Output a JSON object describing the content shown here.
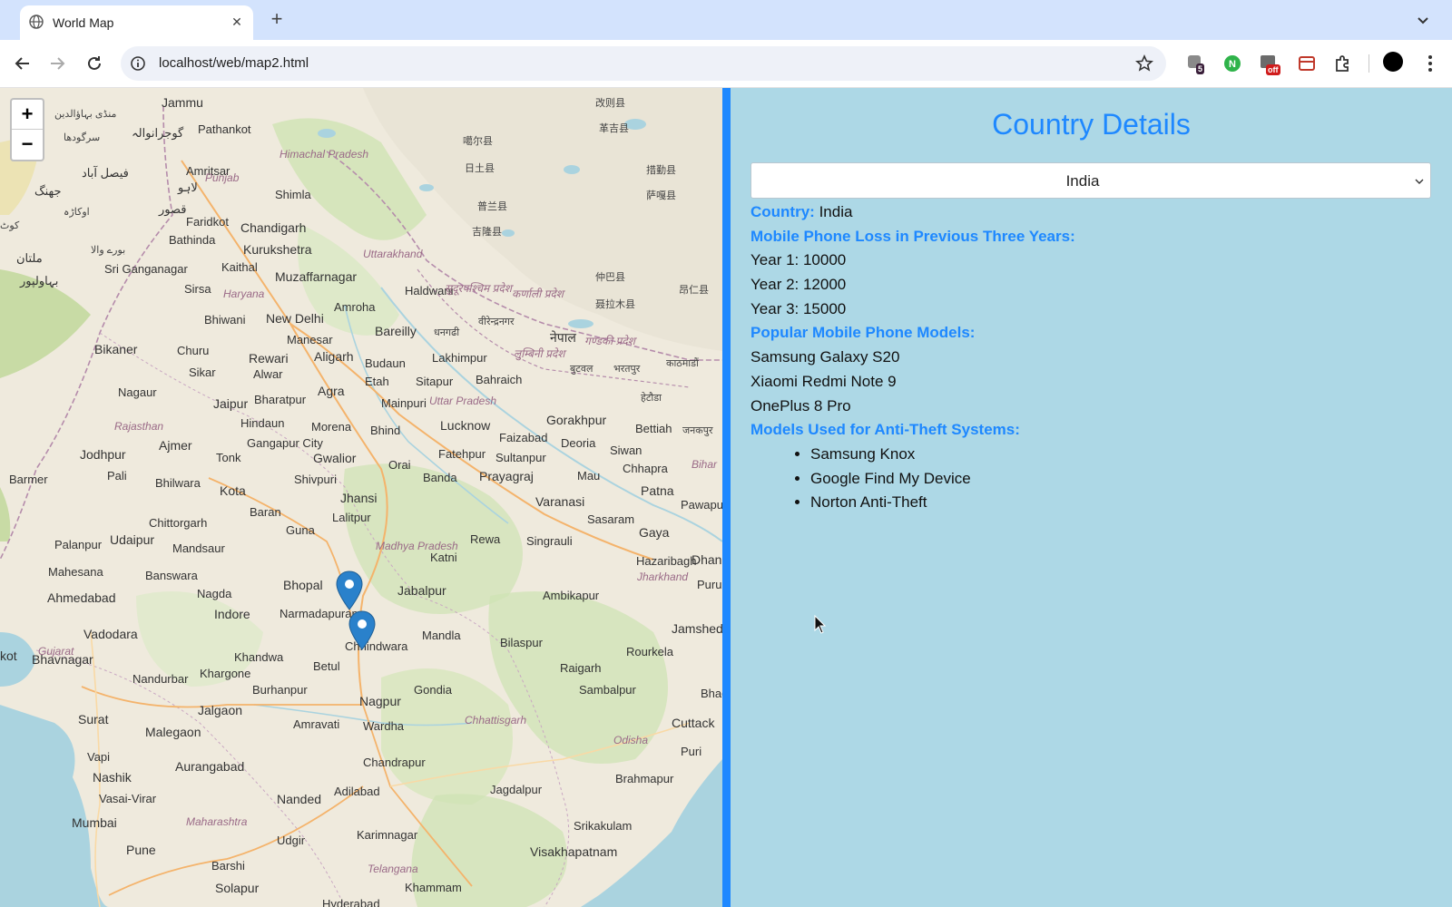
{
  "browser": {
    "tab_title": "World Map",
    "url": "localhost/web/map2.html",
    "extensions": [
      {
        "name": "ext-badge-5",
        "badge": "5"
      },
      {
        "name": "ext-green-n"
      },
      {
        "name": "ext-off",
        "badge": "off"
      },
      {
        "name": "ext-red"
      },
      {
        "name": "puzzle-icon"
      }
    ]
  },
  "map": {
    "zoom_in": "+",
    "zoom_out": "−",
    "labels": {
      "jammu": "Jammu",
      "pathankot": "Pathankot",
      "amritsar": "Amritsar",
      "gujranwala": "گوجرانوالہ",
      "mandi_bahauddin": "منڈی بہاؤالدین",
      "sargodha": "سرگودھا",
      "faisalabad": "فیصل آباد",
      "jhang": "جھنگ",
      "okara": "اوکاڑہ",
      "lahore": "لاہو",
      "qasur": "قصور",
      "burewala": "بورے والا",
      "multan": "ملتان",
      "bahawalpur": "بہاولپور",
      "kot": "کوٹ",
      "himachal": "Himachal Pradesh",
      "shimla": "Shimla",
      "punjab": "Punjab",
      "faridkot": "Faridkot",
      "bathinda": "Bathinda",
      "chandigarh": "Chandigarh",
      "kurukshetra": "Kurukshetra",
      "sri_ganganagar": "Sri Ganganagar",
      "kaithal": "Kaithal",
      "uttarakhand": "Uttarakhand",
      "muzaffarnagar": "Muzaffarnagar",
      "haryana": "Haryana",
      "sirsa": "Sirsa",
      "haldwani": "Haldwani",
      "amroha": "Amroha",
      "bhiwani": "Bhiwani",
      "new_delhi": "New Delhi",
      "bareilly": "Bareilly",
      "manesar": "Manesar",
      "bikaner": "Bikaner",
      "churu": "Churu",
      "rewari": "Rewari",
      "aligarh": "Aligarh",
      "budaun": "Budaun",
      "sikar": "Sikar",
      "alwar": "Alwar",
      "etah": "Etah",
      "sitapur": "Sitapur",
      "nagaur": "Nagaur",
      "jaipur": "Jaipur",
      "agra": "Agra",
      "bharatpur": "Bharatpur",
      "mainpuri": "Mainpuri",
      "uttar_pradesh": "Uttar Pradesh",
      "hindaun": "Hindaun",
      "morena": "Morena",
      "bhind": "Bhind",
      "lucknow": "Lucknow",
      "rajasthan": "Rajasthan",
      "ajmer": "Ajmer",
      "gangapur": "Gangapur City",
      "gwalior": "Gwalior",
      "fatehpur": "Fatehpur",
      "jodhpur": "Jodhpur",
      "tonk": "Tonk",
      "pali": "Pali",
      "orai": "Orai",
      "banda": "Banda",
      "prayagraj": "Prayagraj",
      "shivpuri": "Shivpuri",
      "barmer": "Barmer",
      "bhilwara": "Bhilwara",
      "kota": "Kota",
      "jhansi": "Jhansi",
      "lalitpur": "Lalitpur",
      "baran": "Baran",
      "chittorgarh": "Chittorgarh",
      "guna": "Guna",
      "palanpur": "Palanpur",
      "udaipur": "Udaipur",
      "mandsaur": "Mandsaur",
      "madhya_pradesh": "Madhya Pradesh",
      "katni": "Katni",
      "rewa": "Rewa",
      "singrauli": "Singrauli",
      "mahesana": "Mahesana",
      "banswara": "Banswara",
      "bhopal": "Bhopal",
      "jabalpur": "Jabalpur",
      "ahmedabad": "Ahmedabad",
      "nagda": "Nagda",
      "indore": "Indore",
      "narmadapuram": "Narmadapuram",
      "chhindwara": "Chhindwara",
      "mandla": "Mandla",
      "vadodara": "Vadodara",
      "gujarat": "Gujarat",
      "khandwa": "Khandwa",
      "bhavnagar": "Bhavnagar",
      "kot2": "kot",
      "nandurbar": "Nandurbar",
      "khargone": "Khargone",
      "betul": "Betul",
      "burhanpur": "Burhanpur",
      "jalgaon": "Jalgaon",
      "nagpur": "Nagpur",
      "gondia": "Gondia",
      "surat": "Surat",
      "amravati": "Amravati",
      "wardha": "Wardha",
      "malegaon": "Malegaon",
      "chhattisgarh": "Chhattisgarh",
      "vapi": "Vapi",
      "aurangabad": "Aurangabad",
      "nashik": "Nashik",
      "chandrapur": "Chandrapur",
      "vasai_virar": "Vasai-Virar",
      "nanded": "Nanded",
      "adilabad": "Adilabad",
      "mumbai": "Mumbai",
      "maharashtra": "Maharashtra",
      "pune": "Pune",
      "udgir": "Udgir",
      "karimnagar": "Karimnagar",
      "telangana": "Telangana",
      "barshi": "Barshi",
      "solapur": "Solapur",
      "hyderabad": "Hyderabad",
      "khammam": "Khammam",
      "varanasi": "Varanasi",
      "gorakhpur": "Gorakhpur",
      "faizabad": "Faizabad",
      "deoria": "Deoria",
      "siwan": "Siwan",
      "bettiah": "Bettiah",
      "chhapra": "Chhapra",
      "mau": "Mau",
      "sultanpur": "Sultanpur",
      "bahraich": "Bahraich",
      "lakhimpur": "Lakhimpur",
      "patna": "Patna",
      "gaya": "Gaya",
      "sasaram": "Sasaram",
      "bihar": "Bihar",
      "pawapur": "Pawapur",
      "hazaribagh": "Hazaribagh",
      "dhan": "Dhan",
      "jharkhand": "Jharkhand",
      "purul": "Purul",
      "ambikapur": "Ambikapur",
      "jamshed": "Jamshed",
      "bilaspur": "Bilaspur",
      "rourkela": "Rourkela",
      "raigarh": "Raigarh",
      "sambalpur": "Sambalpur",
      "bhad": "Bhad",
      "cuttack": "Cuttack",
      "odisha": "Odisha",
      "puri": "Puri",
      "brahmapur": "Brahmapur",
      "jagdalpur": "Jagdalpur",
      "srikakulam": "Srikakulam",
      "visakhapatnam": "Visakhapatnam",
      "nepal": "नेपाल",
      "lumbini": "लुम्बिनी प्रदेश",
      "sudurpashchim": "सुदूरपश्चिम प्रदेश",
      "karnali": "कर्णाली प्रदेश",
      "dhangadhi": "धनगढी",
      "birendranagar": "वीरेन्द्रनगर",
      "gandaki": "गण्डकी प्रदेश",
      "butwal": "बुटवल",
      "bharatpur_np": "भरतपुर",
      "kathmandu": "काठमाडौं",
      "hetauda": "हेटौडा",
      "janakpur": "जनकपुर",
      "tib1": "改则县",
      "tib2": "革吉县",
      "tib3": "噶尔县",
      "tib4": "普兰县",
      "tib5": "仲巴县",
      "tib6": "措勤县",
      "tib7": "日土县",
      "tib8": "聂拉木县",
      "tib9": "吉隆县",
      "tib10": "昂仁县",
      "tib11": "萨嘎县"
    }
  },
  "panel": {
    "title": "Country Details",
    "selected_country": "India",
    "country_label": "Country:",
    "country_value": "India",
    "loss_heading": "Mobile Phone Loss in Previous Three Years:",
    "years": [
      "Year 1: 10000",
      "Year 2: 12000",
      "Year 3: 15000"
    ],
    "popular_heading": "Popular Mobile Phone Models:",
    "popular_models": [
      "Samsung Galaxy S20",
      "Xiaomi Redmi Note 9",
      "OnePlus 8 Pro"
    ],
    "antitheft_heading": "Models Used for Anti-Theft Systems:",
    "antitheft_models": [
      "Samsung Knox",
      "Google Find My Device",
      "Norton Anti-Theft"
    ]
  },
  "colors": {
    "accent": "#1e88ff",
    "panel_bg": "#add8e6",
    "marker": "#2a81cb",
    "water": "#aad3df",
    "tabstrip": "#d3e3fd"
  }
}
